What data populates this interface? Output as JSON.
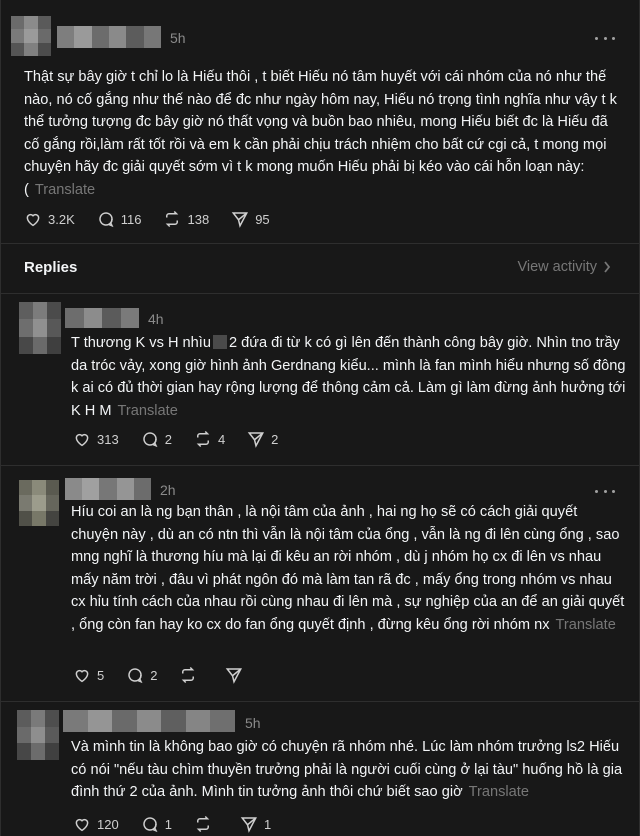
{
  "main_post": {
    "time": "5h",
    "text": "Thật sự bây giờ t chỉ lo là Hiếu thôi , t biết Hiếu nó tâm huyết với cái nhóm của nó như thế nào, nó cố gắng như thế nào để đc như ngày hôm nay, Hiếu nó trọng tình nghĩa như vậy t k thể tưởng tượng đc bây giờ nó thất vọng và buồn bao nhiêu, mong Hiếu biết đc là Hiếu đã cố gắng rồi,làm rất tốt rồi và em k cần phải chịu trách nhiệm cho bất cứ cgi cả, t mong mọi chuyện hãy đc giải quyết sớm vì t k mong muốn Hiếu phải bị kéo vào cái hỗn loạn này:(",
    "translate": "Translate",
    "likes": "3.2K",
    "comments": "116",
    "reposts": "138",
    "shares": "95"
  },
  "replies_header": {
    "label": "Replies",
    "view_activity": "View activity"
  },
  "replies": [
    {
      "time": "4h",
      "text_a": "T thương K vs H nhìu",
      "text_b": "2 đứa đi từ k có gì lên đến thành công bây giờ. Nhìn tno trầy da tróc vảy, xong giờ hình ảnh Gerdnang kiểu... mình là fan mình hiểu nhưng số đông k ai có đủ thời gian hay rộng lượng để thông cảm cả. Làm gì làm đừng ảnh hưởng tới K H M",
      "translate": "Translate",
      "likes": "313",
      "comments": "2",
      "reposts": "4",
      "shares": "2"
    },
    {
      "time": "2h",
      "text": "Híu coi an là ng bạn thân , là nội tâm của ảnh , hai ng họ sẽ có cách giải quyết chuyện này , dù an có ntn thì vẫn là nội tâm của ổng , vẫn là ng đi lên cùng ổng , sao mng nghĩ là thương híu mà lại đi kêu an rời nhóm , dù j nhóm họ cx đi lên vs nhau mấy năm trời , đâu vì phát ngôn đó mà làm tan rã đc , mấy ổng trong nhóm vs nhau cx hỉu tính cách của nhau rồi cùng nhau đi lên mà , sự nghiệp của an để an giải quyết , ổng còn fan hay ko cx do fan ổng quyết định , đừng kêu ổng rời nhóm nx",
      "translate": "Translate",
      "likes": "5",
      "comments": "2",
      "reposts": "",
      "shares": ""
    },
    {
      "time": "5h",
      "text": "Và mình tin là không bao giờ có chuyện rã nhóm nhé. Lúc làm nhóm trưởng ls2 Hiếu có nói \"nếu tàu chìm thuyền trưởng phải là người cuối cùng ở lại tàu\" huống hồ là gia đình thứ 2 của ảnh. Mình tin tưởng ảnh thôi chứ biết sao giờ",
      "translate": "Translate",
      "likes": "120",
      "comments": "1",
      "reposts": "",
      "shares": "1"
    }
  ],
  "icons": {
    "like": "heart-icon",
    "comment": "comment-bubble-icon",
    "repost": "repost-icon",
    "share": "send-icon",
    "more": "more-dots-icon",
    "chevron": "chevron-right-icon"
  }
}
